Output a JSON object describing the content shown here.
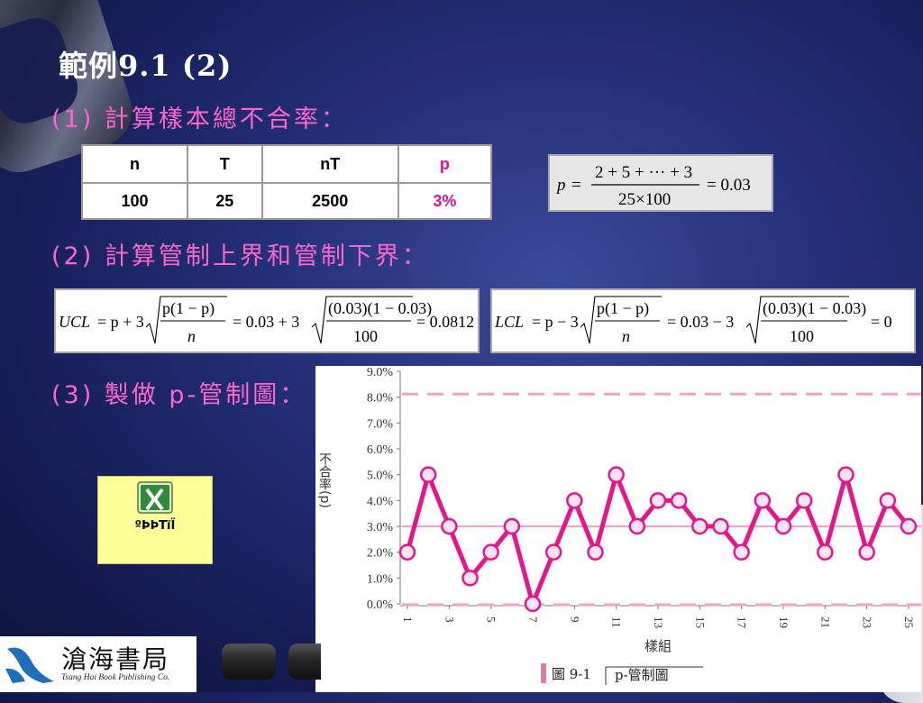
{
  "slide": {
    "title": "範例9.1 (2)",
    "step1": "(1) 計算樣本總不合率：",
    "step2": "(2) 計算管制上界和管制下界：",
    "step3": "(3) 製做 p-管制圖："
  },
  "table": {
    "headers": [
      "n",
      "T",
      "nT",
      "p"
    ],
    "row": [
      "100",
      "25",
      "2500",
      "3%"
    ]
  },
  "formulas": {
    "p_bar": {
      "lhs": "p",
      "num": "2 + 5 + ··· + 3",
      "den": "25×100",
      "result": "= 0.03"
    },
    "ucl": {
      "label": "UCL",
      "text": "UCL = p + 3√(p(1−p)/n) = 0.03 + 3√((0.03)(1−0.03)/100) = 0.0812"
    },
    "lcl": {
      "label": "LCL",
      "text": "LCL = p − 3√(p(1−p)/n) = 0.03 − 3√((0.03)(1−0.03)/100) = 0"
    }
  },
  "excel_button": {
    "label": "ºÞÞTïÏ",
    "icon": "excel-icon"
  },
  "publisher": {
    "name": "滄海書局",
    "english": "Tsang Hai Book Publishing Co."
  },
  "colors": {
    "accent": "#ff66cc",
    "series": "#e8148c",
    "limit": "#f4a0c0"
  },
  "chart_data": {
    "type": "line",
    "ylabel": "不合率(p)",
    "xlabel": "樣組",
    "caption_label": "圖 9-1",
    "caption_text": "p-管制圖",
    "ylim": [
      0,
      9
    ],
    "yticks": [
      "0.0%",
      "1.0%",
      "2.0%",
      "3.0%",
      "4.0%",
      "5.0%",
      "6.0%",
      "7.0%",
      "8.0%",
      "9.0%"
    ],
    "xticks": [
      "1",
      "3",
      "5",
      "7",
      "9",
      "11",
      "13",
      "15",
      "17",
      "19",
      "21",
      "23",
      "25"
    ],
    "x": [
      1,
      2,
      3,
      4,
      5,
      6,
      7,
      8,
      9,
      10,
      11,
      12,
      13,
      14,
      15,
      16,
      17,
      18,
      19,
      20,
      21,
      22,
      23,
      24,
      25
    ],
    "series": [
      {
        "values": [
          2,
          5,
          3,
          1,
          2,
          3,
          0,
          2,
          4,
          2,
          5,
          3,
          4,
          4,
          3,
          3,
          2,
          4,
          3,
          4,
          2,
          5,
          2,
          4,
          3
        ]
      }
    ],
    "ucl": 8.12,
    "center": 3.0,
    "lcl": 0,
    "grid": false
  }
}
